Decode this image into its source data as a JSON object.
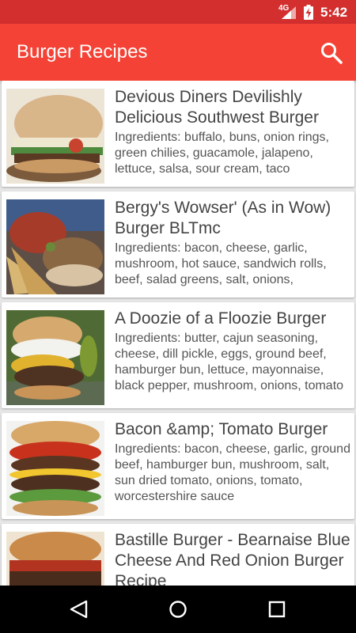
{
  "status_bar": {
    "network": "4G",
    "time": "5:42",
    "icons": [
      "signal-icon",
      "battery-charging-icon"
    ]
  },
  "app_bar": {
    "title": "Burger Recipes",
    "action_icon": "search-icon"
  },
  "recipes": [
    {
      "title": "Devious Diners Devilishly Delicious Southwest Burger",
      "ingredients": "Ingredients: buffalo, buns, onion rings, green chilies, guacamole, jalapeno, lettuce, salsa, sour cream, taco"
    },
    {
      "title": "Bergy's Wowser'  (As in Wow) Burger BLTmc",
      "ingredients": "Ingredients: bacon, cheese, garlic, mushroom, hot sauce, sandwich rolls, beef, salad greens, salt, onions,"
    },
    {
      "title": "A Doozie of a Floozie Burger",
      "ingredients": "Ingredients: butter, cajun seasoning, cheese, dill pickle, eggs, ground beef, hamburger bun, lettuce, mayonnaise, black pepper, mushroom, onions, tomato"
    },
    {
      "title": "Bacon &amp; Tomato Burger",
      "ingredients": "Ingredients: bacon, cheese, garlic, ground beef, hamburger bun, mushroom, salt, sun dried tomato, onions, tomato, worcestershire sauce"
    },
    {
      "title": "Bastille Burger - Bearnaise Blue Cheese And Red Onion Burger Recipe",
      "ingredients": ""
    }
  ],
  "nav_bar": {
    "icons": [
      "back-icon",
      "home-icon",
      "recents-icon"
    ]
  },
  "colors": {
    "status_bar": "#d32f2f",
    "app_bar": "#f44336",
    "background": "#e6e6e6"
  }
}
